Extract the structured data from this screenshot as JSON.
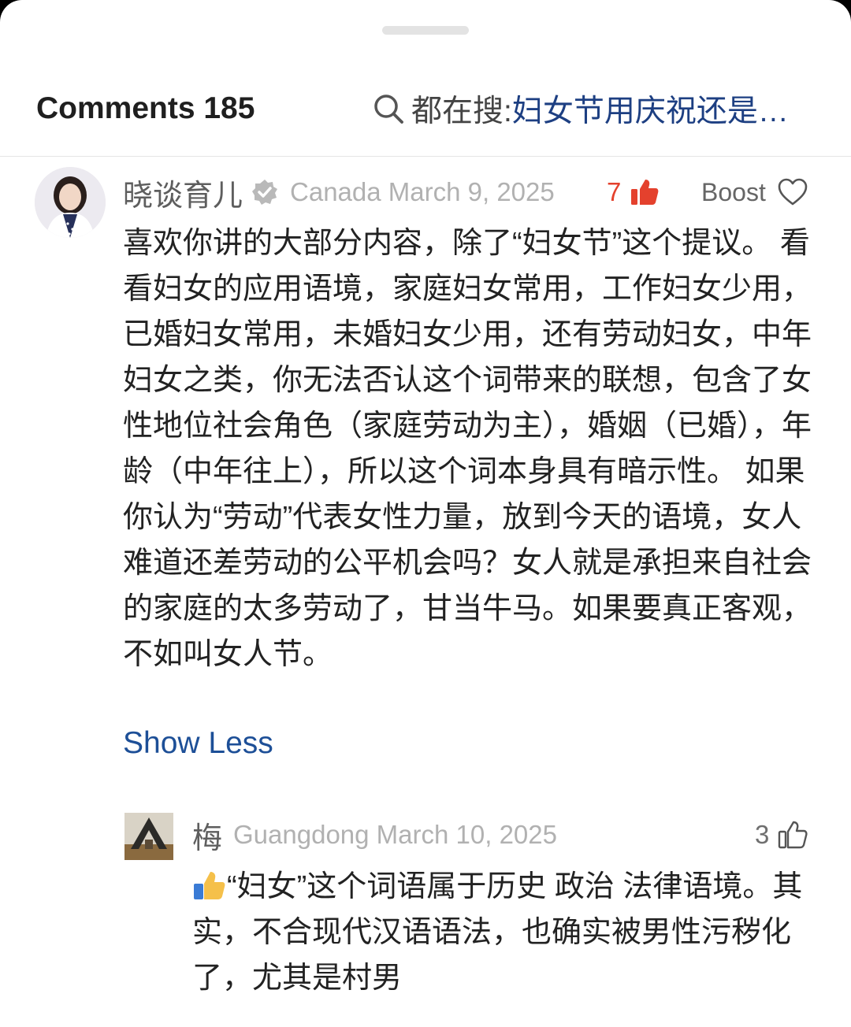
{
  "header": {
    "comments_label": "Comments 185",
    "search_prefix": "都在搜: ",
    "search_term": "妇女节用庆祝还是…"
  },
  "comments": [
    {
      "username": "晓谈育儿",
      "location_date": "Canada March 9, 2025",
      "likes": "7",
      "boost_label": "Boost",
      "text": "喜欢你讲的大部分内容，除了“妇女节”这个提议。 看看妇女的应用语境，家庭妇女常用，工作妇女少用，已婚妇女常用，未婚妇女少用，还有劳动妇女，中年妇女之类，你无法否认这个词带来的联想，包含了女性地位社会角色（家庭劳动为主），婚姻（已婚），年龄（中年往上），所以这个词本身具有暗示性。 如果你认为“劳动”代表女性力量，放到今天的语境，女人难道还差劳动的公平机会吗？女人就是承担来自社会的家庭的太多劳动了，甘当牛马。如果要真正客观，不如叫女人节。",
      "toggle_label": "Show Less"
    }
  ],
  "reply": {
    "username": "梅",
    "location_date": "Guangdong March 10, 2025",
    "likes": "3",
    "text": "“妇女”这个词语属于历史 政治 法律语境。其实，不合现代汉语语法，也确实被男性污秽化了，尤其是村男"
  },
  "colors": {
    "accent_blue": "#1d4f97",
    "like_red": "#e4412d",
    "meta_grey": "#b1b1b1",
    "text": "#222222"
  },
  "icons": [
    "search-icon",
    "verified-icon",
    "thumbs-up-filled-icon",
    "heart-outline-icon",
    "thumbs-up-outline-icon",
    "thumbs-up-emoji-icon"
  ]
}
